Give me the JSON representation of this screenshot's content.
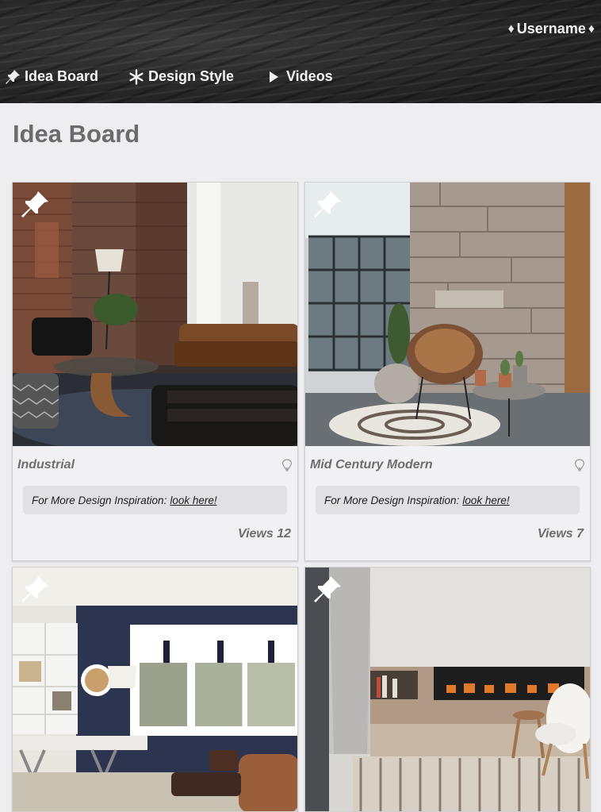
{
  "header": {
    "username": "Username",
    "nav": [
      {
        "label": "Idea Board",
        "icon": "pushpin-icon"
      },
      {
        "label": "Design Style",
        "icon": "asterisk-icon"
      },
      {
        "label": "Videos",
        "icon": "play-icon"
      }
    ]
  },
  "page": {
    "title": "Idea Board"
  },
  "cards": [
    {
      "title": "Industrial",
      "inspo_text": "For More Design Inspiration:",
      "inspo_link": "look here!",
      "views": "Views 12"
    },
    {
      "title": "Mid Century Modern",
      "inspo_text": "For More Design Inspiration:",
      "inspo_link": "look here!",
      "views": "Views 7"
    },
    {
      "title": "",
      "inspo_text": "",
      "inspo_link": "",
      "views": ""
    },
    {
      "title": "",
      "inspo_text": "",
      "inspo_link": "",
      "views": ""
    }
  ]
}
